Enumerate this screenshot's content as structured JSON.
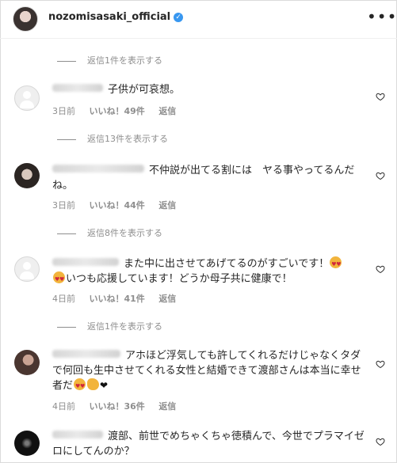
{
  "header": {
    "username": "nozomisasaki_official",
    "more_label": "•••"
  },
  "reply_toggles": [
    "返信1件を表示する",
    "返信13件を表示する",
    "返信8件を表示する",
    "返信1件を表示する"
  ],
  "comments": [
    {
      "text": "子供が可哀想。",
      "time": "3日前",
      "likes": "いいね！49件",
      "reply": "返信"
    },
    {
      "text": "不仲説が出てる割には　ヤる事やってるんだね。",
      "time": "3日前",
      "likes": "いいね！44件",
      "reply": "返信"
    },
    {
      "text_a": "また中に出させてあげてるのがすごいです！",
      "text_b": "いつも応援しています！どうか母子共に健康で！",
      "time": "4日前",
      "likes": "いいね！41件",
      "reply": "返信"
    },
    {
      "text_a": "アホほど浮気しても許してくれるだけじゃなくタダで何回も生中させてくれる女性と結婚できて渡部さんは本当に幸せ者だ",
      "time": "4日前",
      "likes": "いいね！36件",
      "reply": "返信"
    },
    {
      "text": "渡部、前世でめちゃくちゃ徳積んで、今世でプラマイゼロにしてんのか？"
    }
  ],
  "icons": {
    "verified": "verified-badge-icon",
    "heart": "heart-outline-icon",
    "avatar_default": "default-avatar-icon"
  },
  "colors": {
    "verified": "#3897f0",
    "meta": "#8e8e8e",
    "text": "#262626"
  }
}
